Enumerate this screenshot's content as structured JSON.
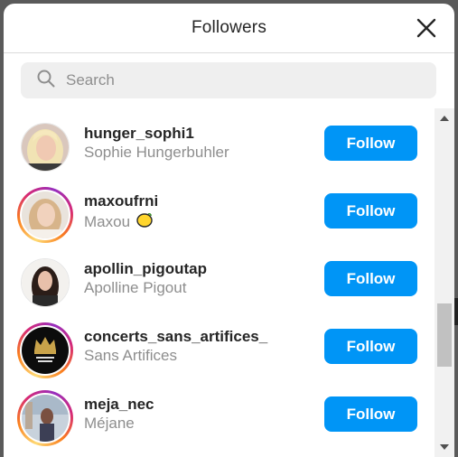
{
  "modal": {
    "title": "Followers"
  },
  "search": {
    "placeholder": "Search"
  },
  "followers": [
    {
      "username": "hunger_sophi1",
      "full_name": "Sophie Hungerbuhler",
      "story_ring": false,
      "button": "Follow"
    },
    {
      "username": "maxoufrni",
      "full_name": "Maxou",
      "emoji": "lemon",
      "story_ring": true,
      "button": "Follow"
    },
    {
      "username": "apollin_pigoutap",
      "full_name": "Apolline Pigout",
      "story_ring": false,
      "button": "Follow"
    },
    {
      "username": "concerts_sans_artifices_",
      "full_name": "Sans Artifices",
      "story_ring": true,
      "button": "Follow"
    },
    {
      "username": "meja_nec",
      "full_name": "Méjane",
      "story_ring": true,
      "button": "Follow"
    }
  ],
  "colors": {
    "follow_button": "#0095f6",
    "muted_text": "#8e8e8e",
    "primary_text": "#262626"
  },
  "icons": {
    "close": "close-icon",
    "search": "search-icon"
  }
}
